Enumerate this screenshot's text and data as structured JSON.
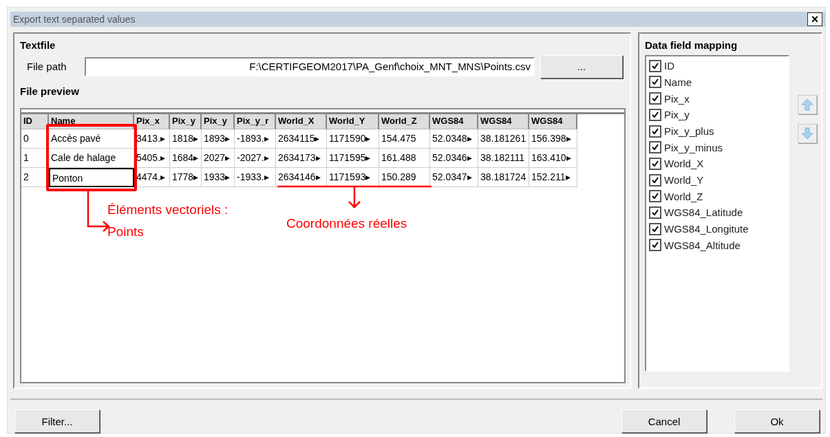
{
  "window": {
    "title": "Export text separated values",
    "close": "×"
  },
  "textfile": {
    "heading": "Textfile",
    "file_path_label": "File path",
    "file_path": "F:\\CERTIFGEOM2017\\PA_Genf\\choix_MNT_MNS\\Points.csv",
    "browse_button": "..."
  },
  "preview": {
    "heading": "File preview",
    "columns": [
      "ID",
      "Name",
      "Pix_x",
      "Pix_y",
      "Pix_y",
      "Pix_y_r",
      "World_X",
      "World_Y",
      "World_Z",
      "WGS84",
      "WGS84",
      "WGS84"
    ],
    "rows": [
      {
        "selected": false,
        "cells": [
          "0",
          "Accès pavé",
          "3413.▸",
          "1818▸",
          "1893▸",
          "-1893.▸",
          "2634115▸",
          "1171590▸",
          "154.475",
          "52.0348▸",
          "38.181261",
          "156.398▸"
        ]
      },
      {
        "selected": false,
        "cells": [
          "1",
          "Cale de halage",
          "5405.▸",
          "1684▸",
          "2027▸",
          "-2027.▸",
          "2634173▸",
          "1171595▸",
          "161.488",
          "52.0346▸",
          "38.182111",
          "163.410▸"
        ]
      },
      {
        "selected": true,
        "cells": [
          "2",
          "Ponton",
          "4474.▸",
          "1778▸",
          "1933▸",
          "-1933.▸",
          "2634146▸",
          "1171593▸",
          "150.289",
          "52.0347▸",
          "38.181724",
          "152.211▸"
        ]
      }
    ]
  },
  "annotations": [
    {
      "kind": "name-box",
      "text": "Éléments vectoriels : Points"
    },
    {
      "kind": "coord-underline",
      "text": "Coordonnées réelles"
    }
  ],
  "mapping": {
    "heading": "Data field mapping",
    "fields": [
      {
        "label": "ID",
        "checked": true
      },
      {
        "label": "Name",
        "checked": true
      },
      {
        "label": "Pix_x",
        "checked": true
      },
      {
        "label": "Pix_y",
        "checked": true
      },
      {
        "label": "Pix_y_plus",
        "checked": true
      },
      {
        "label": "Pix_y_minus",
        "checked": true
      },
      {
        "label": "World_X",
        "checked": true
      },
      {
        "label": "World_Y",
        "checked": true
      },
      {
        "label": "World_Z",
        "checked": true
      },
      {
        "label": "WGS84_Latitude",
        "checked": true
      },
      {
        "label": "WGS84_Longitute",
        "checked": true
      },
      {
        "label": "WGS84_Altitude",
        "checked": true
      }
    ]
  },
  "buttons": {
    "filter": "Filter...",
    "cancel": "Cancel",
    "ok": "Ok"
  }
}
